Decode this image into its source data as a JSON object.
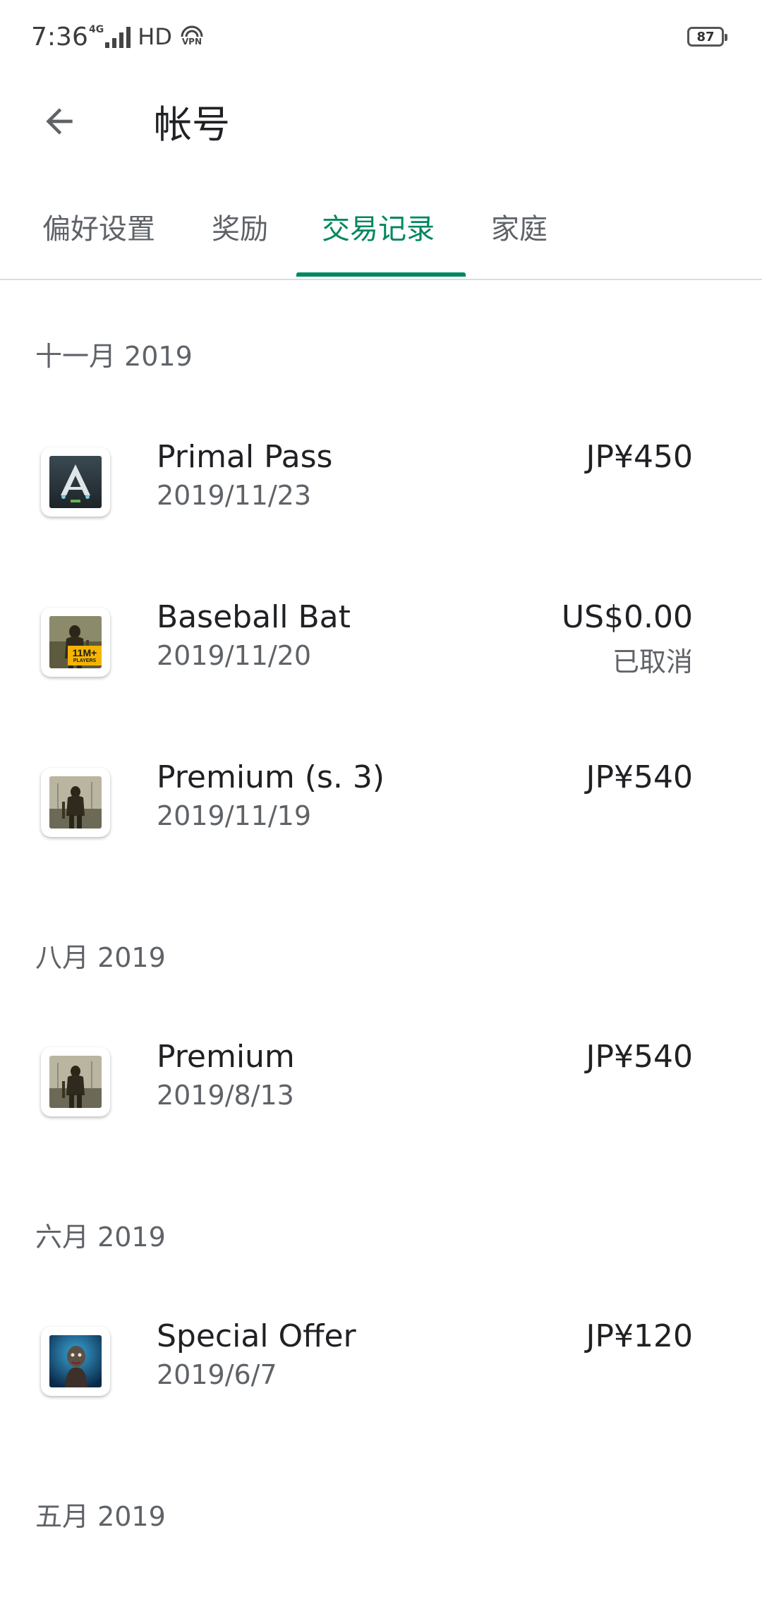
{
  "status_bar": {
    "time": "7:36",
    "network": "4G",
    "hd_label": "HD",
    "vpn_label": "VPN",
    "battery_level": "87"
  },
  "app_bar": {
    "back_icon": "arrow-back-icon",
    "title": "帐号"
  },
  "tabs": [
    {
      "label": "偏好设置",
      "active": false
    },
    {
      "label": "奖励",
      "active": false
    },
    {
      "label": "交易记录",
      "active": true
    },
    {
      "label": "家庭",
      "active": false
    }
  ],
  "accent_color": "#01875f",
  "sections": [
    {
      "header": "十一月 2019",
      "items": [
        {
          "title": "Primal Pass",
          "date": "2019/11/23",
          "price": "JP¥450",
          "status": "",
          "icon": "ark-game-icon"
        },
        {
          "title": "Baseball Bat",
          "date": "2019/11/20",
          "price": "US$0.00",
          "status": "已取消",
          "icon": "survival-game-icon",
          "badge": "11M+",
          "badge_sub": "PLAYERS"
        },
        {
          "title": "Premium (s. 3)",
          "date": "2019/11/19",
          "price": "JP¥540",
          "status": "",
          "icon": "survival-game-icon"
        }
      ]
    },
    {
      "header": "八月 2019",
      "items": [
        {
          "title": "Premium",
          "date": "2019/8/13",
          "price": "JP¥540",
          "status": "",
          "icon": "survival-game-icon"
        }
      ]
    },
    {
      "header": "六月 2019",
      "items": [
        {
          "title": "Special Offer",
          "date": "2019/6/7",
          "price": "JP¥120",
          "status": "",
          "icon": "zombie-game-icon"
        }
      ]
    },
    {
      "header": "五月 2019",
      "items": []
    }
  ]
}
